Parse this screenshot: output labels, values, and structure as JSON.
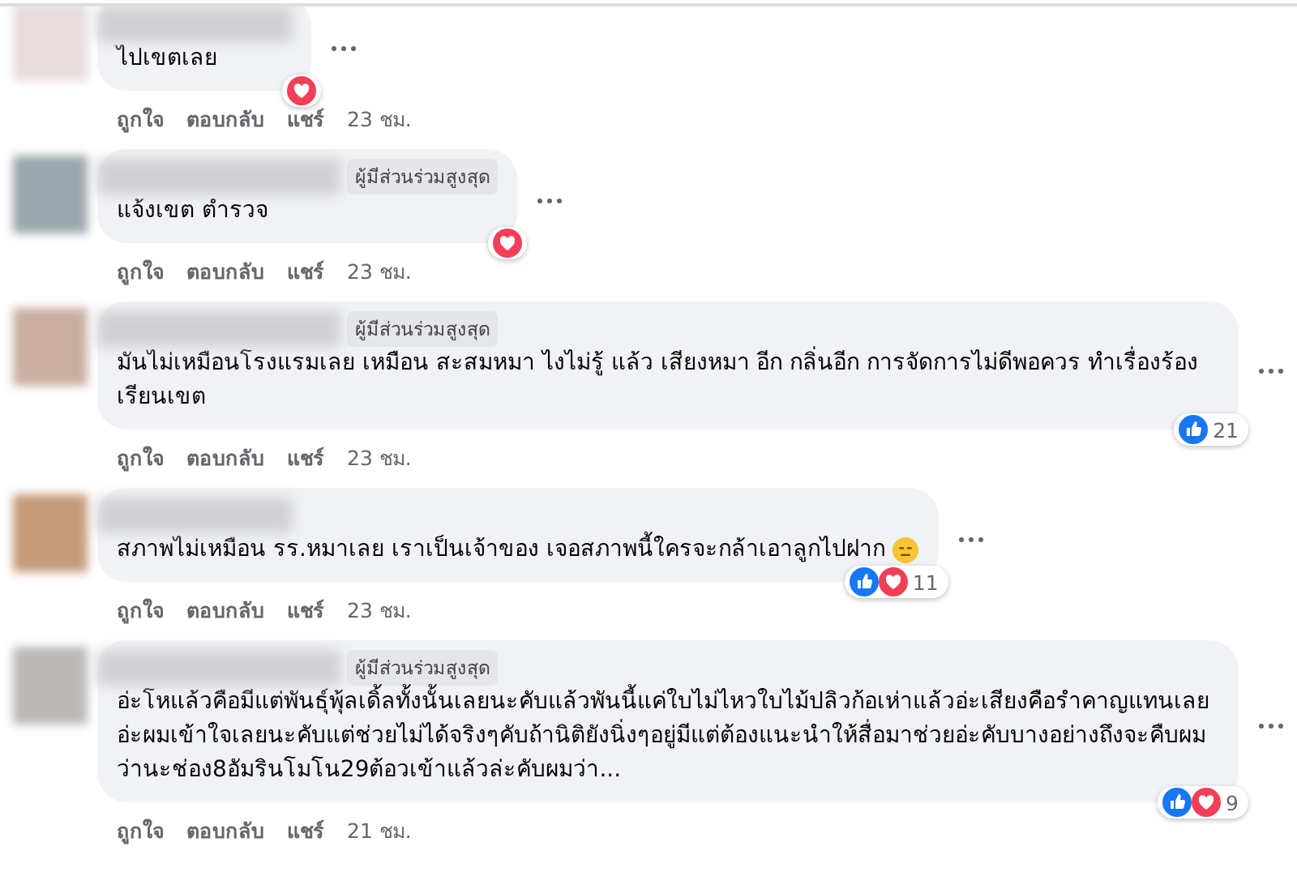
{
  "comments": [
    {
      "top_contributor": false,
      "text": "ไปเขตเลย",
      "reactions": [
        {
          "kind": "love"
        }
      ],
      "actions": [
        "ถูกใจ",
        "ตอบกลับ",
        "แชร์"
      ],
      "time": "23 ชม."
    },
    {
      "top_contributor": true,
      "badge": "ผู้มีส่วนร่วมสูงสุด",
      "text": "แจ้งเขต ตำรวจ",
      "reactions": [
        {
          "kind": "love"
        }
      ],
      "actions": [
        "ถูกใจ",
        "ตอบกลับ",
        "แชร์"
      ],
      "time": "23 ชม."
    },
    {
      "top_contributor": true,
      "badge": "ผู้มีส่วนร่วมสูงสุด",
      "text": "มันไม่เหมือนโรงแรมเลย เหมือน สะสมหมา ไงไม่รู้ แล้ว เสียงหมา อีก กลิ่นอีก การจัดการไม่ดีพอควร ทำเรื่องร้องเรียนเขต",
      "reactions": [
        {
          "kind": "like"
        }
      ],
      "reaction_count": "21",
      "actions": [
        "ถูกใจ",
        "ตอบกลับ",
        "แชร์"
      ],
      "time": "23 ชม."
    },
    {
      "top_contributor": false,
      "text": "สภาพไม่เหมือน รร.หมาเลย เราเป็นเจ้าของ เจอสภาพนี้ใครจะกล้าเอาลูกไปฝาก",
      "emoji": {
        "kind": "neutral"
      },
      "reactions": [
        {
          "kind": "like"
        },
        {
          "kind": "love"
        }
      ],
      "reaction_count": "11",
      "actions": [
        "ถูกใจ",
        "ตอบกลับ",
        "แชร์"
      ],
      "time": "23 ชม."
    },
    {
      "top_contributor": true,
      "badge": "ผู้มีส่วนร่วมสูงสุด",
      "text": "อ่ะโหแล้วคือมีแต่พันธุ์พุ้ลเดิ้ลทั้งนั้นเลยนะคับแล้วพันนี้แค่ใบไม่ไหวใบไม้ปลิวก้อเห่าแล้วอ่ะเสียงคือรำคาญแทนเลยอ่ะผมเข้าใจเลยนะคับแต่ช่วยไม่ได้จริงๆคับถ้านิติยังนิ่งๆอยู่มีแต่ต้องแนะนำให้สื่อมาช่วยอ่ะคับบางอย่างถึงจะคืบผมว่านะช่อง8อัมรินโมโน29ต้อวเข้าแล้วล่ะคับผมว่า...",
      "reactions": [
        {
          "kind": "like"
        },
        {
          "kind": "love"
        }
      ],
      "reaction_count": "9",
      "actions": [
        "ถูกใจ",
        "ตอบกลับ",
        "แชร์"
      ],
      "time": "21 ชม."
    }
  ]
}
